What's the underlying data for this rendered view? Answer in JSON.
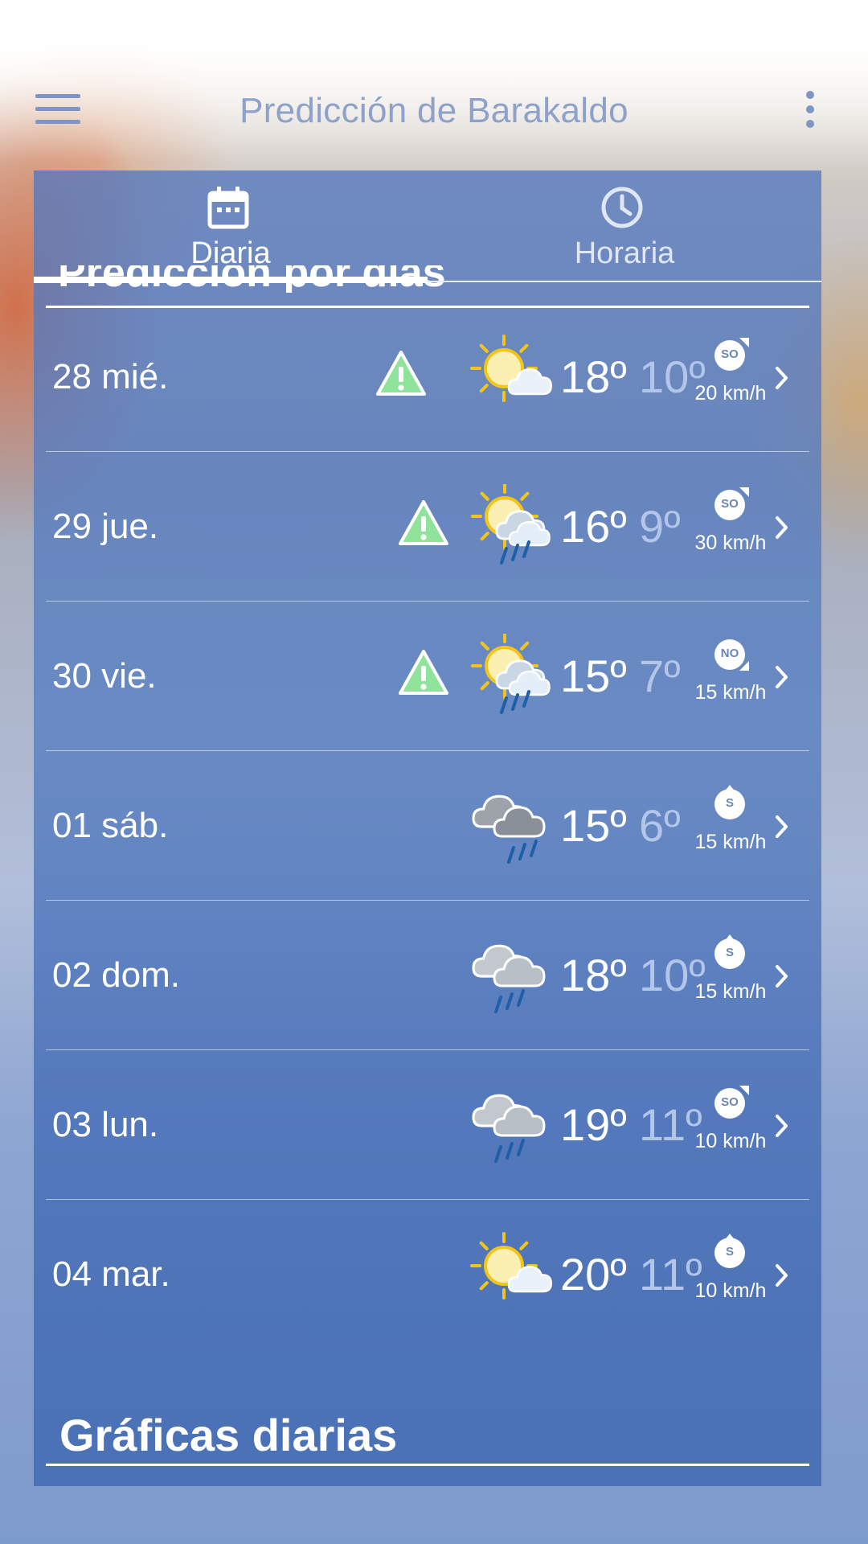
{
  "app_bar": {
    "title": "Predicción de Barakaldo"
  },
  "tabs": [
    {
      "label": "Diaria",
      "active": true,
      "icon": "calendar-icon"
    },
    {
      "label": "Horaria",
      "active": false,
      "icon": "clock-icon"
    }
  ],
  "section_peek": "Predicción por días",
  "forecast": [
    {
      "day": "28 mié.",
      "warning": true,
      "weather_icon": "sun-cloud-icon",
      "max": "18º",
      "min": "10º",
      "wind_dir": "SO",
      "wind_speed": "20 km/h"
    },
    {
      "day": "29 jue.",
      "warning": true,
      "weather_icon": "sun-cloud-rain-icon",
      "max": "16º",
      "min": "9º",
      "wind_dir": "SO",
      "wind_speed": "30 km/h"
    },
    {
      "day": "30 vie.",
      "warning": true,
      "weather_icon": "sun-cloud-rain-icon",
      "max": "15º",
      "min": "7º",
      "wind_dir": "NO",
      "wind_speed": "15 km/h"
    },
    {
      "day": "01 sáb.",
      "warning": false,
      "weather_icon": "dark-cloud-rain-icon",
      "max": "15º",
      "min": "6º",
      "wind_dir": "S",
      "wind_speed": "15 km/h"
    },
    {
      "day": "02 dom.",
      "warning": false,
      "weather_icon": "cloud-rain-icon",
      "max": "18º",
      "min": "10º",
      "wind_dir": "S",
      "wind_speed": "15 km/h"
    },
    {
      "day": "03 lun.",
      "warning": false,
      "weather_icon": "cloud-rain-icon",
      "max": "19º",
      "min": "11º",
      "wind_dir": "SO",
      "wind_speed": "10 km/h"
    },
    {
      "day": "04 mar.",
      "warning": false,
      "weather_icon": "sun-cloud-icon",
      "max": "20º",
      "min": "11º",
      "wind_dir": "S",
      "wind_speed": "10 km/h"
    }
  ],
  "graficas_title": "Gráficas diarias",
  "colors": {
    "panel": "#5478be",
    "warning_green": "#8fe39a",
    "sun": "#f3c51b",
    "rain": "#1f5fa8",
    "min_temp": "#b3c6ea"
  }
}
